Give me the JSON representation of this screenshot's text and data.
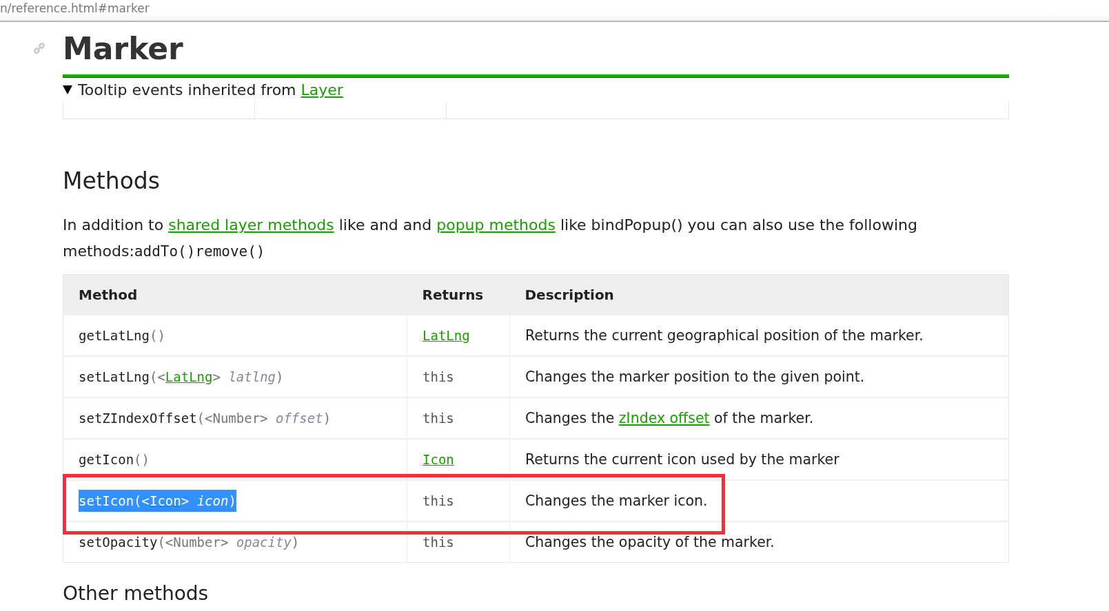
{
  "address_bar": {
    "url": "n/reference.html#marker"
  },
  "page_title": "Marker",
  "collapsible": {
    "expanded": true,
    "label": "Tooltip events inherited from ",
    "link": "Layer"
  },
  "methods_heading": "Methods",
  "intro": [
    {
      "kind": "text",
      "text": "In addition to "
    },
    {
      "kind": "link",
      "text": "shared layer methods"
    },
    {
      "kind": "text",
      "text": " like and and "
    },
    {
      "kind": "link",
      "text": "popup methods"
    },
    {
      "kind": "text",
      "text": " like bindPopup() you can also use the following methods:"
    },
    {
      "kind": "code",
      "text": "addTo()remove()"
    }
  ],
  "table": {
    "columns": [
      "Method",
      "Returns",
      "Description"
    ],
    "rows": [
      {
        "selected": false,
        "annotated": false,
        "method": [
          {
            "kind": "name",
            "text": "getLatLng"
          },
          {
            "kind": "punct",
            "text": "()"
          }
        ],
        "returns": {
          "kind": "link",
          "text": "LatLng"
        },
        "description": [
          {
            "kind": "text",
            "text": "Returns the current geographical position of the marker."
          }
        ]
      },
      {
        "selected": false,
        "annotated": false,
        "method": [
          {
            "kind": "name",
            "text": "setLatLng"
          },
          {
            "kind": "punct",
            "text": "(<"
          },
          {
            "kind": "type-link",
            "text": "LatLng"
          },
          {
            "kind": "punct",
            "text": "> "
          },
          {
            "kind": "param",
            "text": "latlng"
          },
          {
            "kind": "punct",
            "text": ")"
          }
        ],
        "returns": {
          "kind": "text",
          "text": "this"
        },
        "description": [
          {
            "kind": "text",
            "text": "Changes the marker position to the given point."
          }
        ]
      },
      {
        "selected": false,
        "annotated": false,
        "method": [
          {
            "kind": "name",
            "text": "setZIndexOffset"
          },
          {
            "kind": "punct",
            "text": "(<Number> "
          },
          {
            "kind": "param",
            "text": "offset"
          },
          {
            "kind": "punct",
            "text": ")"
          }
        ],
        "returns": {
          "kind": "text",
          "text": "this"
        },
        "description": [
          {
            "kind": "text",
            "text": "Changes the "
          },
          {
            "kind": "link",
            "text": "zIndex offset"
          },
          {
            "kind": "text",
            "text": " of the marker."
          }
        ]
      },
      {
        "selected": false,
        "annotated": false,
        "method": [
          {
            "kind": "name",
            "text": "getIcon"
          },
          {
            "kind": "punct",
            "text": "()"
          }
        ],
        "returns": {
          "kind": "link",
          "text": "Icon"
        },
        "description": [
          {
            "kind": "text",
            "text": "Returns the current icon used by the marker"
          }
        ]
      },
      {
        "selected": true,
        "annotated": true,
        "method": [
          {
            "kind": "name",
            "text": "setIcon"
          },
          {
            "kind": "punct",
            "text": "(<"
          },
          {
            "kind": "type-link",
            "text": "Icon"
          },
          {
            "kind": "punct",
            "text": "> "
          },
          {
            "kind": "param",
            "text": "icon"
          },
          {
            "kind": "punct",
            "text": ")"
          }
        ],
        "returns": {
          "kind": "text",
          "text": "this"
        },
        "description": [
          {
            "kind": "text",
            "text": "Changes the marker icon."
          }
        ]
      },
      {
        "selected": false,
        "annotated": false,
        "method": [
          {
            "kind": "name",
            "text": "setOpacity"
          },
          {
            "kind": "punct",
            "text": "(<Number> "
          },
          {
            "kind": "param",
            "text": "opacity"
          },
          {
            "kind": "punct",
            "text": ")"
          }
        ],
        "returns": {
          "kind": "text",
          "text": "this"
        },
        "description": [
          {
            "kind": "text",
            "text": "Changes the opacity of the marker."
          }
        ]
      }
    ]
  },
  "next_heading": "Other methods"
}
